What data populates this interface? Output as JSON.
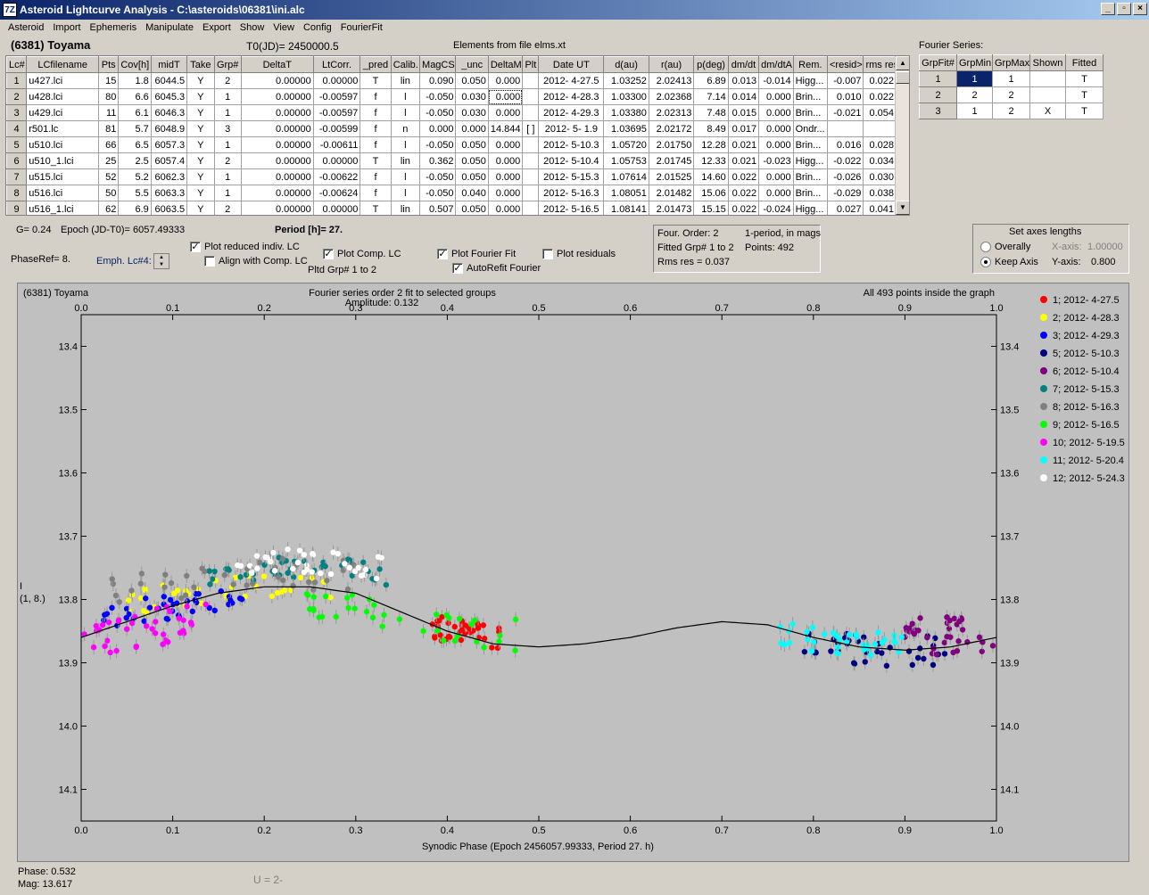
{
  "window": {
    "title": "Asteroid Lightcurve Analysis - C:\\asteroids\\06381\\ini.alc",
    "icon": "7Z"
  },
  "menu": [
    "Asteroid",
    "Import",
    "Ephemeris",
    "Manipulate",
    "Export",
    "Show",
    "View",
    "Config",
    "FourierFit"
  ],
  "header": {
    "asteroid": "(6381) Toyama",
    "t0": "T0(JD)= 2450000.5",
    "elements": "Elements from file elms.xt",
    "fourier_label": "Fourier Series:"
  },
  "lc_table": {
    "columns": [
      "Lc#",
      "LCfilename",
      "Pts",
      "Cov[h]",
      "midT",
      "Take",
      "Grp#",
      "DeltaT",
      "LtCorr.",
      "_pred",
      "Calib.",
      "MagCS",
      "_unc",
      "DeltaM",
      "Plt",
      "Date UT",
      "d(au)",
      "r(au)",
      "p(deg)",
      "dm/dt",
      "dm/dtA",
      "Rem.",
      "<resid>",
      "rms res"
    ],
    "rows": [
      [
        "1",
        "u427.lci",
        "15",
        "1.8",
        "6044.5",
        "Y",
        "2",
        "0.00000",
        "0.00000",
        "T",
        "lin",
        "0.090",
        "0.050",
        "0.000",
        "",
        "2012- 4-27.5",
        "1.03252",
        "2.02413",
        "6.89",
        "0.013",
        "-0.014",
        "Higg...",
        "-0.007",
        "0.022"
      ],
      [
        "2",
        "u428.lci",
        "80",
        "6.6",
        "6045.3",
        "Y",
        "1",
        "0.00000",
        "-0.00597",
        "f",
        "l",
        "-0.050",
        "0.030",
        "0.000",
        "",
        "2012- 4-28.3",
        "1.03300",
        "2.02368",
        "7.14",
        "0.014",
        "0.000",
        "Brin...",
        "0.010",
        "0.022"
      ],
      [
        "3",
        "u429.lci",
        "11",
        "6.1",
        "6046.3",
        "Y",
        "1",
        "0.00000",
        "-0.00597",
        "f",
        "l",
        "-0.050",
        "0.030",
        "0.000",
        "",
        "2012- 4-29.3",
        "1.03380",
        "2.02313",
        "7.48",
        "0.015",
        "0.000",
        "Brin...",
        "-0.021",
        "0.054"
      ],
      [
        "4",
        "r501.lc",
        "81",
        "5.7",
        "6048.9",
        "Y",
        "3",
        "0.00000",
        "-0.00599",
        "f",
        "n",
        "0.000",
        "0.000",
        "14.844",
        "[ ]",
        "2012- 5- 1.9",
        "1.03695",
        "2.02172",
        "8.49",
        "0.017",
        "0.000",
        "Ondr...",
        "",
        ""
      ],
      [
        "5",
        "u510.lci",
        "66",
        "6.5",
        "6057.3",
        "Y",
        "1",
        "0.00000",
        "-0.00611",
        "f",
        "l",
        "-0.050",
        "0.050",
        "0.000",
        "",
        "2012- 5-10.3",
        "1.05720",
        "2.01750",
        "12.28",
        "0.021",
        "0.000",
        "Brin...",
        "0.016",
        "0.028"
      ],
      [
        "6",
        "u510_1.lci",
        "25",
        "2.5",
        "6057.4",
        "Y",
        "2",
        "0.00000",
        "0.00000",
        "T",
        "lin",
        "0.362",
        "0.050",
        "0.000",
        "",
        "2012- 5-10.4",
        "1.05753",
        "2.01745",
        "12.33",
        "0.021",
        "-0.023",
        "Higg...",
        "-0.022",
        "0.034"
      ],
      [
        "7",
        "u515.lci",
        "52",
        "5.2",
        "6062.3",
        "Y",
        "1",
        "0.00000",
        "-0.00622",
        "f",
        "l",
        "-0.050",
        "0.050",
        "0.000",
        "",
        "2012- 5-15.3",
        "1.07614",
        "2.01525",
        "14.60",
        "0.022",
        "0.000",
        "Brin...",
        "-0.026",
        "0.030"
      ],
      [
        "8",
        "u516.lci",
        "50",
        "5.5",
        "6063.3",
        "Y",
        "1",
        "0.00000",
        "-0.00624",
        "f",
        "l",
        "-0.050",
        "0.040",
        "0.000",
        "",
        "2012- 5-16.3",
        "1.08051",
        "2.01482",
        "15.06",
        "0.022",
        "0.000",
        "Brin...",
        "-0.029",
        "0.038"
      ],
      [
        "9",
        "u516_1.lci",
        "62",
        "6.9",
        "6063.5",
        "Y",
        "2",
        "0.00000",
        "0.00000",
        "T",
        "lin",
        "0.507",
        "0.050",
        "0.000",
        "",
        "2012- 5-16.5",
        "1.08141",
        "2.01473",
        "15.15",
        "0.022",
        "-0.024",
        "Higg...",
        "0.027",
        "0.041"
      ]
    ]
  },
  "fourier_table": {
    "columns": [
      "GrpFit#",
      "GrpMin",
      "GrpMax",
      "Shown",
      "Fitted"
    ],
    "rows": [
      [
        "1",
        "1",
        "1",
        "",
        "T"
      ],
      [
        "2",
        "2",
        "2",
        "",
        "T"
      ],
      [
        "3",
        "1",
        "2",
        "X",
        "T"
      ]
    ]
  },
  "controls": {
    "g": "G= 0.24",
    "epoch": "Epoch (JD-T0)= 6057.49333",
    "period": "Period [h]= 27.",
    "phaseref": "PhaseRef= 8.",
    "emph": "Emph. Lc#4:",
    "plot_reduced": "Plot reduced indiv. LC",
    "align": "Align with Comp. LC",
    "plot_comp": "Plot Comp. LC",
    "pltd_grp": "Pltd Grp#  1   to   2",
    "plot_fourier": "Plot Fourier Fit",
    "autorefit": "AutoRefit Fourier",
    "plot_residuals": "Plot residuals",
    "checked": {
      "plot_reduced": true,
      "align": false,
      "plot_comp": true,
      "plot_fourier": true,
      "autorefit": true,
      "plot_residuals": false
    }
  },
  "fit_info": {
    "order": "Four. Order:  2",
    "mode": "1-period, in mags",
    "fitted": "Fitted Grp# 1 to 2",
    "points": "Points: 492",
    "rms": "Rms res    = 0.037"
  },
  "axes_box": {
    "title": "Set axes lengths",
    "overally": "Overally",
    "keep": "Keep Axis",
    "xaxis_label": "X-axis:",
    "xaxis_value": "1.00000",
    "yaxis_label": "Y-axis:",
    "yaxis_value": "0.800",
    "selected": "keep"
  },
  "plot": {
    "title_left": "(6381) Toyama",
    "title_center": "Fourier series order 2 fit to selected groups",
    "amplitude": "Amplitude: 0.132",
    "title_right": "All 493 points inside the graph",
    "y_label_1": "I",
    "y_label_2": "(1, 8.)",
    "x_label": "Synodic Phase (Epoch 2456057.99333, Period 27. h)"
  },
  "status": {
    "phase": "Phase:  0.532",
    "mag": "Mag:   13.617",
    "u": "U = 2-"
  },
  "chart_data": {
    "type": "scatter",
    "x_range": [
      0,
      1
    ],
    "y_range": [
      13.35,
      14.15
    ],
    "y_inverted": true,
    "x_ticks": [
      "0.0",
      "0.1",
      "0.2",
      "0.3",
      "0.4",
      "0.5",
      "0.6",
      "0.7",
      "0.8",
      "0.9",
      "1.0"
    ],
    "y_ticks": [
      "13.4",
      "13.5",
      "13.6",
      "13.7",
      "13.8",
      "13.9",
      "14.0",
      "14.1"
    ],
    "fourier_fit": [
      [
        0,
        13.86
      ],
      [
        0.05,
        13.835
      ],
      [
        0.1,
        13.81
      ],
      [
        0.15,
        13.79
      ],
      [
        0.2,
        13.78
      ],
      [
        0.25,
        13.78
      ],
      [
        0.3,
        13.79
      ],
      [
        0.35,
        13.82
      ],
      [
        0.4,
        13.85
      ],
      [
        0.45,
        13.87
      ],
      [
        0.5,
        13.875
      ],
      [
        0.55,
        13.87
      ],
      [
        0.6,
        13.86
      ],
      [
        0.65,
        13.845
      ],
      [
        0.7,
        13.835
      ],
      [
        0.75,
        13.84
      ],
      [
        0.8,
        13.86
      ],
      [
        0.85,
        13.875
      ],
      [
        0.9,
        13.88
      ],
      [
        0.95,
        13.875
      ],
      [
        1.0,
        13.86
      ]
    ],
    "series": [
      {
        "name": "1; 2012- 4-27.5",
        "color": "#ff0000",
        "range": [
          0.38,
          0.46
        ],
        "center": 13.845,
        "spread": 0.02
      },
      {
        "name": "2; 2012- 4-28.3",
        "color": "#ffff00",
        "range": [
          0.05,
          0.29
        ],
        "center": 13.78,
        "spread": 0.02
      },
      {
        "name": "3; 2012- 4-29.3",
        "color": "#0000ff",
        "range": [
          0.02,
          0.18
        ],
        "center": 13.81,
        "spread": 0.02
      },
      {
        "name": "5; 2012- 5-10.3",
        "color": "#000080",
        "range": [
          0.78,
          0.95
        ],
        "center": 13.885,
        "spread": 0.025
      },
      {
        "name": "6; 2012- 5-10.4",
        "color": "#800080",
        "range": [
          0.9,
          1.0
        ],
        "center": 13.84,
        "spread": 0.03
      },
      {
        "name": "7; 2012- 5-15.3",
        "color": "#008080",
        "range": [
          0.14,
          0.34
        ],
        "center": 13.72,
        "spread": 0.02
      },
      {
        "name": "8; 2012- 5-16.3",
        "color": "#808080",
        "range": [
          0.03,
          0.3
        ],
        "center": 13.74,
        "spread": 0.025
      },
      {
        "name": "9; 2012- 5-16.5",
        "color": "#00ff00",
        "range": [
          0.23,
          0.48
        ],
        "center": 13.84,
        "spread": 0.025
      },
      {
        "name": "10; 2012- 5-19.5",
        "color": "#ff00ff",
        "range": [
          0.0,
          0.14
        ],
        "center": 13.87,
        "spread": 0.03
      },
      {
        "name": "11; 2012- 5-20.4",
        "color": "#00ffff",
        "range": [
          0.76,
          0.9
        ],
        "center": 13.865,
        "spread": 0.02
      },
      {
        "name": "12; 2012- 5-24.3",
        "color": "#ffffff",
        "range": [
          0.17,
          0.33
        ],
        "center": 13.7,
        "spread": 0.02
      }
    ]
  }
}
